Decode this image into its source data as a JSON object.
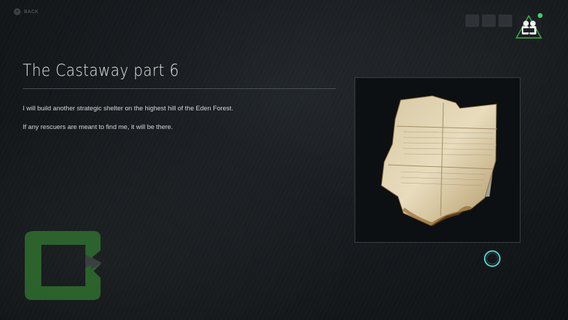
{
  "nav": {
    "back_label": "BACK"
  },
  "header": {
    "squares": 3,
    "avatar_status_color": "#3ed26a"
  },
  "document": {
    "title": "The Castaway part 6",
    "paragraphs": [
      "I will build another strategic shelter on the highest hill of the Eden Forest.",
      "If any rescuers are meant to find me, it will be there."
    ]
  },
  "colors": {
    "accent_green": "#3a8a3a",
    "cursor_teal": "#4fd6cf"
  }
}
